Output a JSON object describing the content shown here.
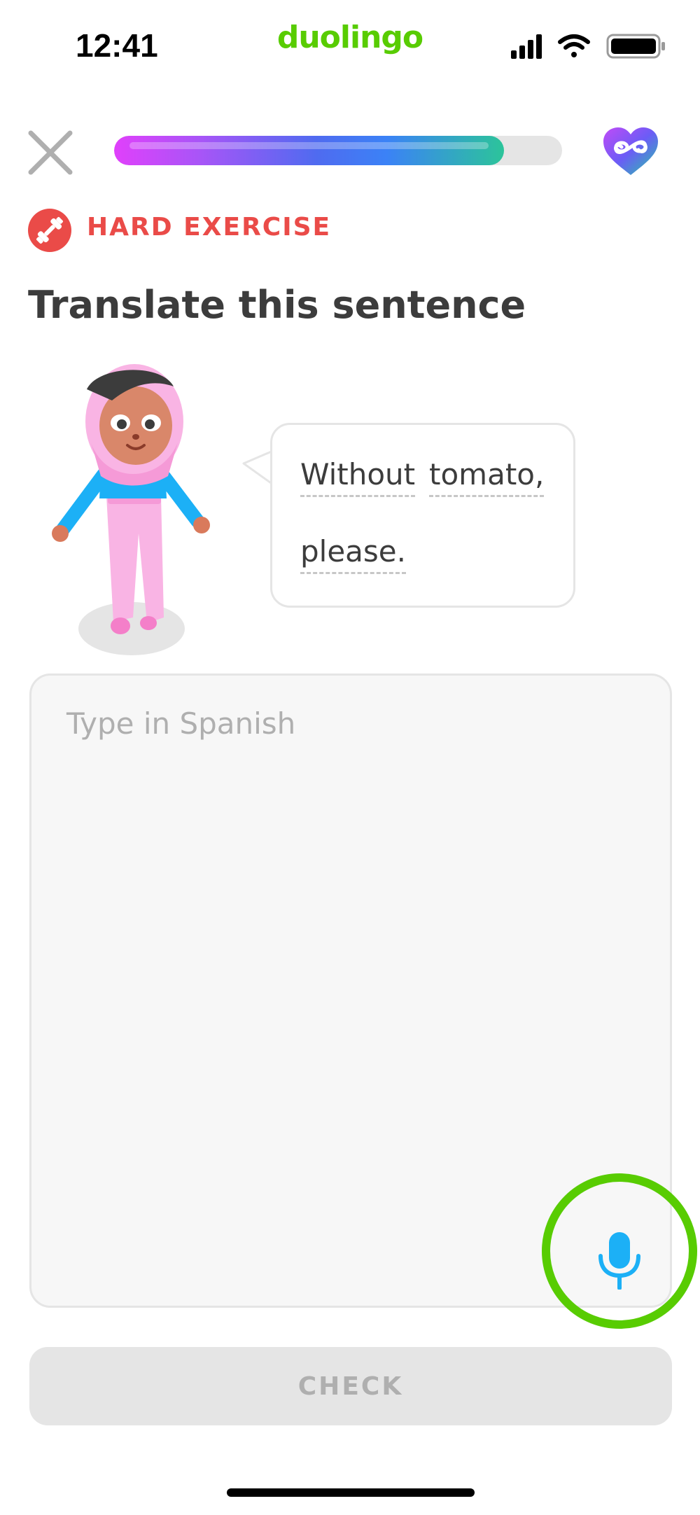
{
  "status_bar": {
    "time": "12:41",
    "brand": "duolingo",
    "icons": [
      "signal-icon",
      "wifi-icon",
      "battery-icon"
    ]
  },
  "lesson": {
    "progress": 0.87,
    "hearts_icon": "infinity-heart-icon",
    "close_icon": "close-icon"
  },
  "exercise": {
    "badge_label": "HARD EXERCISE",
    "badge_icon": "dumbbell-icon",
    "title": "Translate this sentence",
    "prompt_words": [
      "Without",
      "tomato,",
      "please."
    ]
  },
  "answer": {
    "placeholder": "Type in Spanish",
    "value": "",
    "mic_icon": "microphone-icon"
  },
  "actions": {
    "check_label": "CHECK"
  },
  "colors": {
    "brand_green": "#58cc02",
    "hard_red": "#ea4b48",
    "mic_blue": "#1cb0f6",
    "title_text": "#3c3c3c",
    "disabled_gray": "#e5e5e5"
  }
}
